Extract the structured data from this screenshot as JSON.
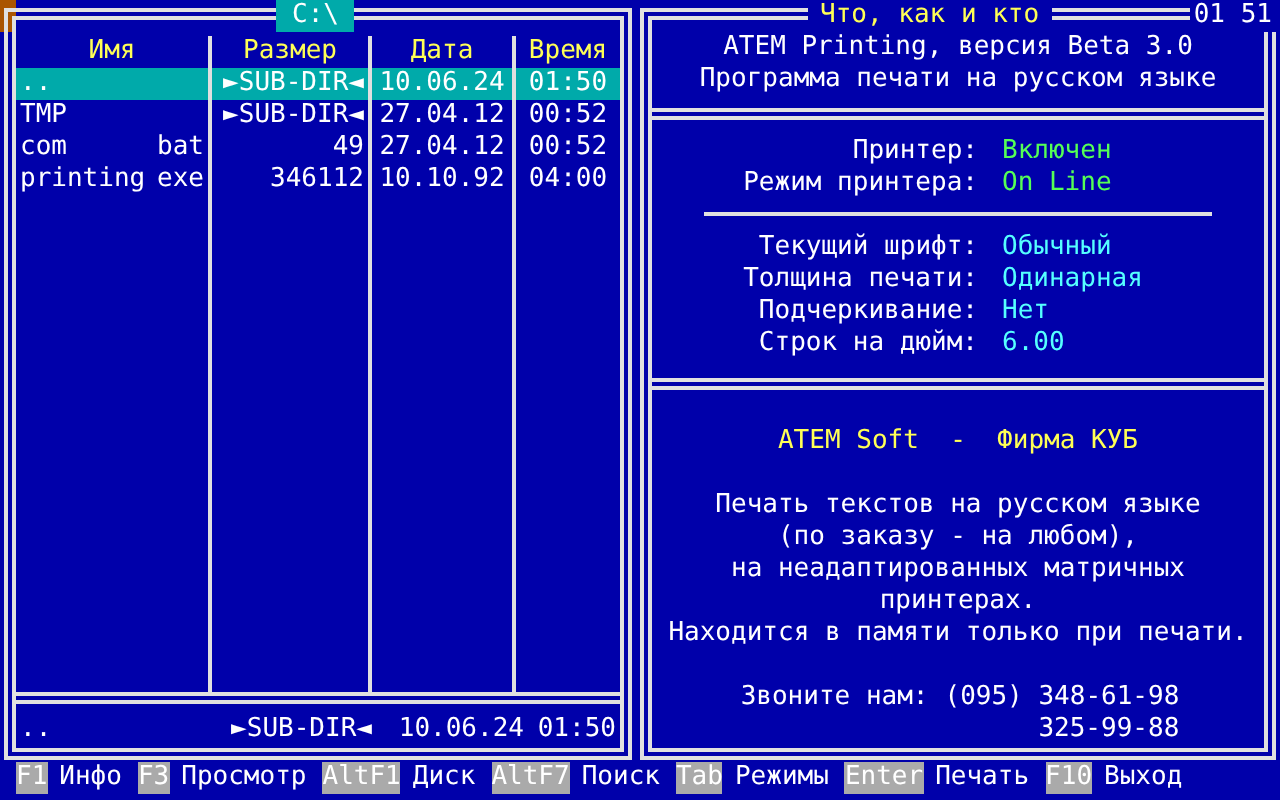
{
  "left_panel": {
    "path": "C:\\",
    "columns": [
      "Имя",
      "Размер",
      "Дата",
      "Время"
    ],
    "rows": [
      {
        "name": "..",
        "size": "►SUB-DIR◄",
        "date": "10.06.24",
        "time": "01:50",
        "selected": true
      },
      {
        "name": "TMP",
        "size": "►SUB-DIR◄",
        "date": "27.04.12",
        "time": "00:52",
        "selected": false
      },
      {
        "name": "com",
        "ext": "bat",
        "size": "49",
        "date": "27.04.12",
        "time": "00:52",
        "selected": false
      },
      {
        "name": "printing",
        "ext": "exe",
        "size": "346112",
        "date": "10.10.92",
        "time": "04:00",
        "selected": false
      }
    ],
    "footer": {
      "name": "..",
      "size": "►SUB-DIR◄",
      "date": "10.06.24",
      "time": "01:50"
    }
  },
  "right_panel": {
    "title": "Что, как и кто",
    "clock": "01 51",
    "header": [
      "ATEM Printing, версия Beta 3.0",
      "Программа печати на русском языке"
    ],
    "printer_status": [
      {
        "label": "Принтер:",
        "value": "Включен"
      },
      {
        "label": "Режим принтера:",
        "value": "On Line"
      }
    ],
    "font_settings": [
      {
        "label": "Текущий шрифт:",
        "value": "Обычный"
      },
      {
        "label": "Толщина печати:",
        "value": "Одинарная"
      },
      {
        "label": "Подчеркивание:",
        "value": "Нет"
      },
      {
        "label": "Строк на дюйм:",
        "value": "6.00"
      }
    ],
    "company": "ATEM Soft  -  Фирма КУБ",
    "description": [
      "Печать текстов на русском языке",
      "(по заказу - на любом),",
      "на неадаптированных матричных",
      "принтерах.",
      "Находится в памяти только при печати."
    ],
    "contact": {
      "label": "Звоните нам:",
      "phones": [
        "(095) 348-61-98",
        "325-99-88"
      ]
    }
  },
  "function_keys": [
    {
      "key": "F1",
      "label": "Инфо"
    },
    {
      "key": "F3",
      "label": "Просмотр"
    },
    {
      "key": "AltF1",
      "label": "Диск"
    },
    {
      "key": "AltF7",
      "label": "Поиск"
    },
    {
      "key": "Tab",
      "label": "Режимы"
    },
    {
      "key": "Enter",
      "label": "Печать"
    },
    {
      "key": "F10",
      "label": "Выход"
    }
  ]
}
